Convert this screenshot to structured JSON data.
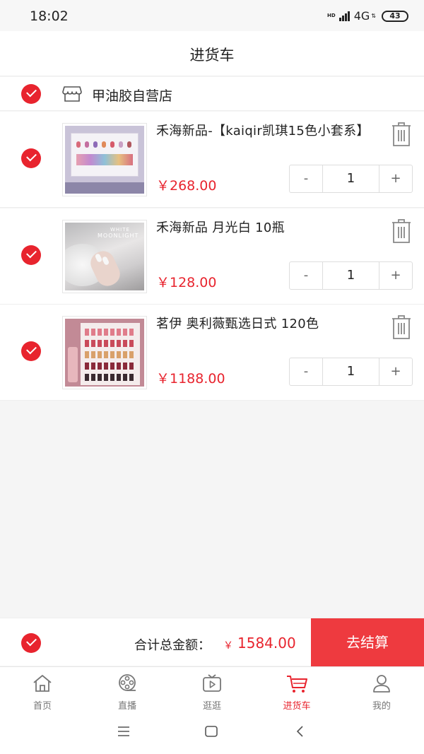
{
  "status_bar": {
    "time": "18:02",
    "hd": "HD",
    "network": "4G",
    "net_arrows": "⇅",
    "battery": "43"
  },
  "header": {
    "title": "进货车"
  },
  "store": {
    "name": "甲油胶自营店",
    "icon": "store-icon",
    "checked": true
  },
  "items": [
    {
      "title": "禾海新品-【kaiqir凯琪15色小套系】",
      "price": "￥268.00",
      "qty": "1",
      "minus": "-",
      "plus": "+",
      "checked": true
    },
    {
      "title": "禾海新品  月光白  10瓶",
      "price": "￥128.00",
      "qty": "1",
      "minus": "-",
      "plus": "+",
      "checked": true
    },
    {
      "title": "茗伊  奥利薇甄选日式  120色",
      "price": "￥1188.00",
      "qty": "1",
      "minus": "-",
      "plus": "+",
      "checked": true
    }
  ],
  "thumb_text": {
    "moonlight_small": "WHITE",
    "moonlight_big": "MOONLIGHT"
  },
  "summary": {
    "label": "合计总金额：",
    "currency": "￥",
    "amount": "1584.00",
    "checkout": "去结算"
  },
  "tabs": [
    {
      "label": "首页",
      "icon": "home-icon"
    },
    {
      "label": "直播",
      "icon": "film-reel-icon"
    },
    {
      "label": "逛逛",
      "icon": "tv-play-icon"
    },
    {
      "label": "进货车",
      "icon": "cart-icon",
      "active": true
    },
    {
      "label": "我的",
      "icon": "user-icon"
    }
  ],
  "colors": {
    "accent": "#e8242e",
    "checkout_bg": "#ee3a3f"
  }
}
